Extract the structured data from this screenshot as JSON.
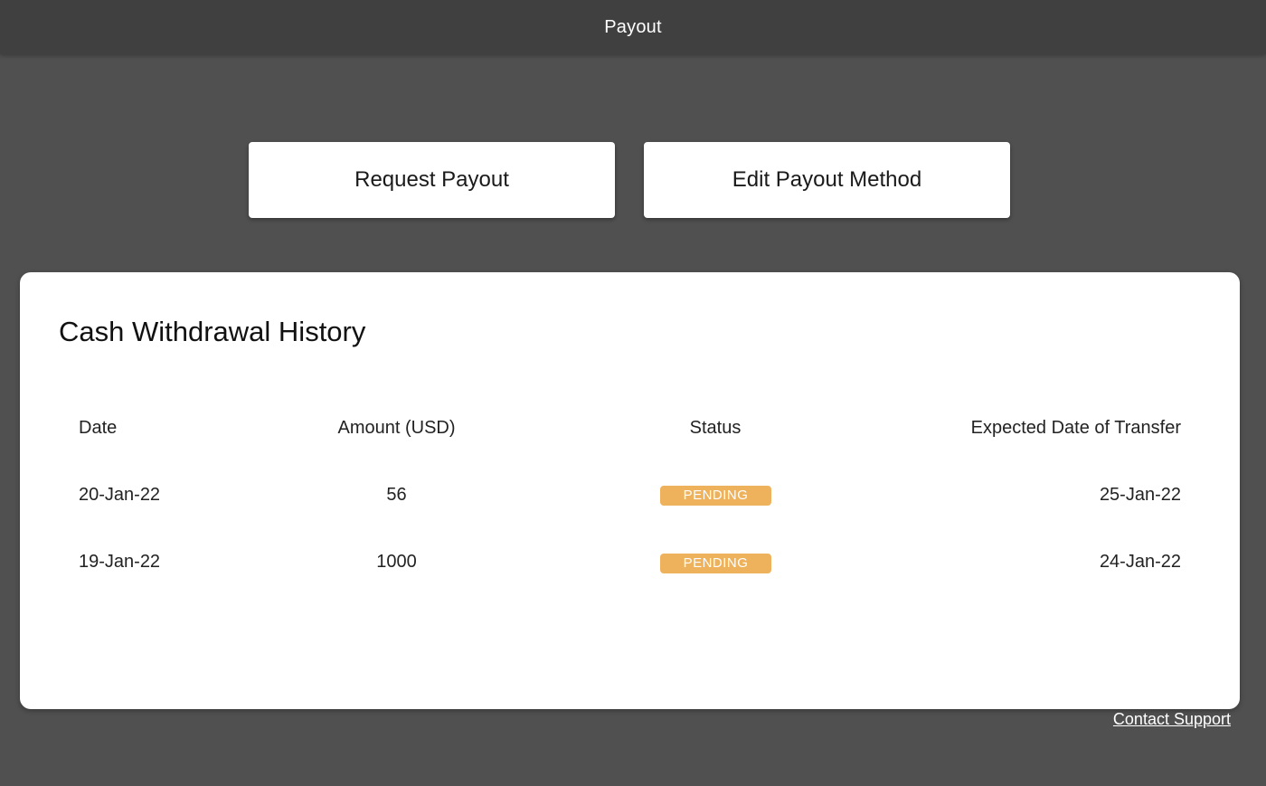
{
  "header": {
    "title": "Payout"
  },
  "actions": {
    "request_label": "Request Payout",
    "edit_label": "Edit Payout Method"
  },
  "history": {
    "title": "Cash Withdrawal History",
    "columns": [
      "Date",
      "Amount (USD)",
      "Status",
      "Expected Date of Transfer"
    ],
    "rows": [
      {
        "date": "20-Jan-22",
        "amount": "56",
        "status": "PENDING",
        "expected": "25-Jan-22"
      },
      {
        "date": "19-Jan-22",
        "amount": "1000",
        "status": "PENDING",
        "expected": "24-Jan-22"
      }
    ]
  },
  "footer": {
    "support_label": "Contact Support"
  },
  "colors": {
    "background": "#505050",
    "topbar": "#404040",
    "pending_badge": "#efb25c"
  }
}
